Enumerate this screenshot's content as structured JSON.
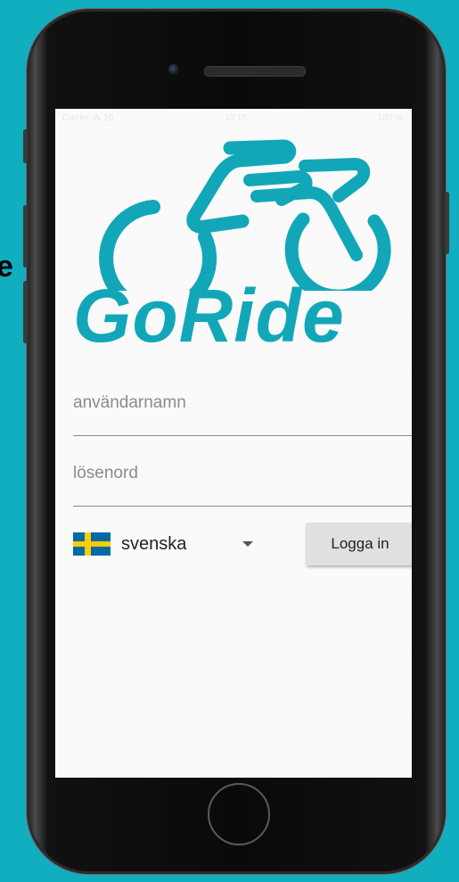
{
  "side_text": "e",
  "status_bar": {
    "left": "Carrier ⁂ 10",
    "middle": "10:15",
    "right": "100 %"
  },
  "brand": {
    "name": "GoRide",
    "color": "#12a7b8"
  },
  "login_form": {
    "username_placeholder": "användarnamn",
    "password_placeholder": "lösenord",
    "language_selected": "svenska",
    "language_flag": "sweden-flag",
    "login_button": "Logga in"
  },
  "colors": {
    "background": "#11aebf",
    "accent": "#12a7b8",
    "button_bg": "#e0e0e0"
  }
}
